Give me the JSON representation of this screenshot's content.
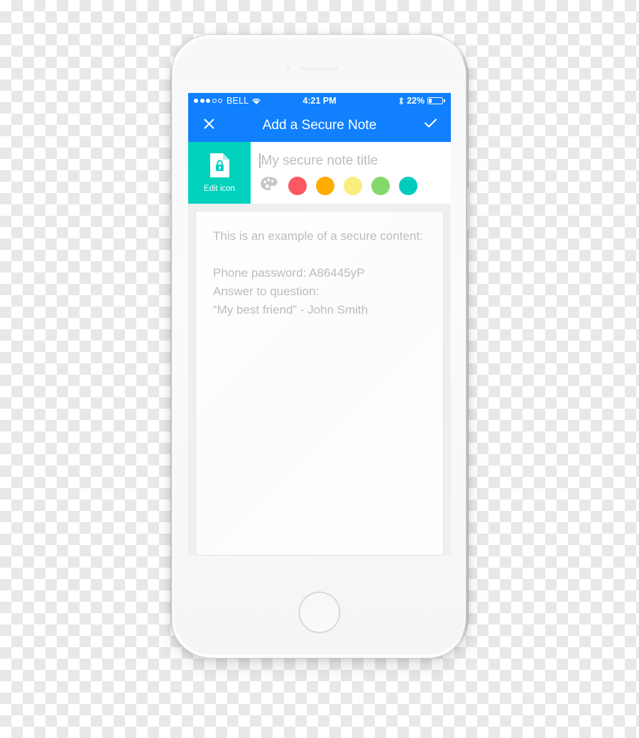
{
  "status_bar": {
    "carrier": "BELL",
    "signal_dots_filled": 3,
    "signal_dots_total": 5,
    "wifi_icon": "wifi-icon",
    "time": "4:21 PM",
    "bluetooth_icon": "bluetooth-icon",
    "battery_percent_label": "22%",
    "battery_level": 22,
    "background_color": "#1080ff",
    "text_color": "#ffffff"
  },
  "nav_bar": {
    "title": "Add a Secure Note",
    "close_icon": "close-x-icon",
    "save_icon": "checkmark-icon",
    "background_color": "#1080ff"
  },
  "editor_header": {
    "edit_icon_tile": {
      "label": "Edit icon",
      "icon": "secure-document-lock-icon",
      "background_color": "#00d2bd"
    },
    "title_field": {
      "placeholder": "My secure note title",
      "value": "",
      "caret_visible": true
    },
    "palette_button": {
      "icon": "color-palette-icon",
      "color": "#c6c6c6"
    },
    "color_swatches": [
      {
        "name": "red",
        "hex": "#fb5861"
      },
      {
        "name": "orange",
        "hex": "#ffab00"
      },
      {
        "name": "yellow",
        "hex": "#faed80"
      },
      {
        "name": "green",
        "hex": "#82d969"
      },
      {
        "name": "teal",
        "hex": "#00c9bd"
      }
    ]
  },
  "note_body": {
    "content": "This is an example of a secure content:\n\nPhone password: A86445yP\nAnswer to question:\n“My best friend” - John Smith",
    "text_color": "#bcbcbc",
    "card_background": "#fcfcfc"
  },
  "device": {
    "home_button": "home-button",
    "power_button": "power-button",
    "volume_up_button": "volume-up-button",
    "volume_down_button": "volume-down-button",
    "mute_switch": "mute-switch"
  }
}
